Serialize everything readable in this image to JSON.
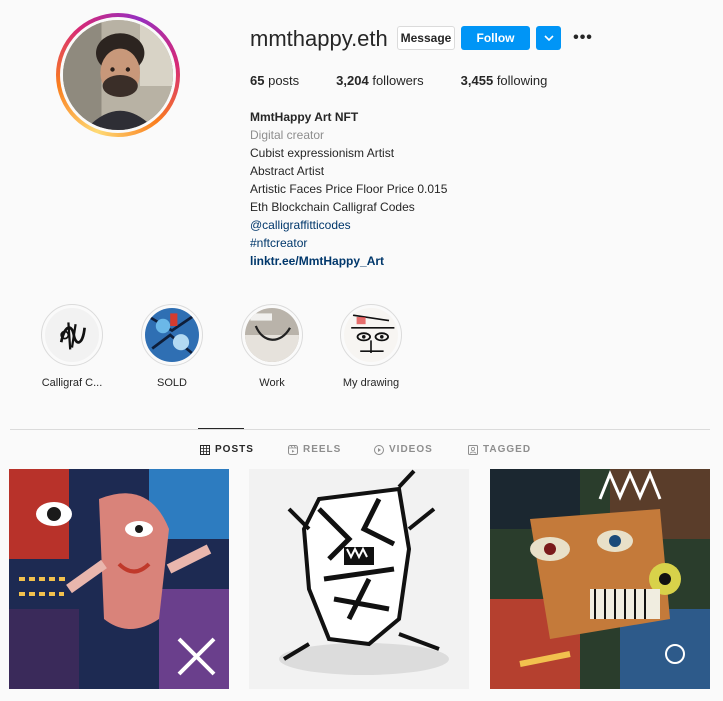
{
  "profile": {
    "username": "mmthappy.eth",
    "message_label": "Message",
    "follow_label": "Follow",
    "more_label": "•••"
  },
  "stats": {
    "posts_count": "65",
    "posts_label": "posts",
    "followers_count": "3,204",
    "followers_label": "followers",
    "following_count": "3,455",
    "following_label": "following"
  },
  "bio": {
    "name": "MmtHappy Art NFT",
    "category": "Digital creator",
    "lines": [
      "Cubist expressionism Artist",
      "Abstract Artist",
      "Artistic Faces Price Floor Price 0.015",
      "Eth Blockchain Calligraf Codes"
    ],
    "mention": "@calligraffitticodes",
    "hashtag": "#nftcreator",
    "website": "linktr.ee/MmtHappy_Art"
  },
  "highlights": [
    {
      "label": "Calligraf C..."
    },
    {
      "label": "SOLD"
    },
    {
      "label": "Work"
    },
    {
      "label": "My drawing"
    }
  ],
  "tabs": [
    {
      "label": "POSTS",
      "icon": "grid-icon",
      "active": true
    },
    {
      "label": "REELS",
      "icon": "reels-icon",
      "active": false
    },
    {
      "label": "VIDEOS",
      "icon": "video-icon",
      "active": false
    },
    {
      "label": "TAGGED",
      "icon": "tagged-icon",
      "active": false
    }
  ],
  "colors": {
    "accent": "#0095f6",
    "text": "#262626",
    "muted": "#8e8e8e",
    "link": "#00376b",
    "background": "#fafafa"
  }
}
